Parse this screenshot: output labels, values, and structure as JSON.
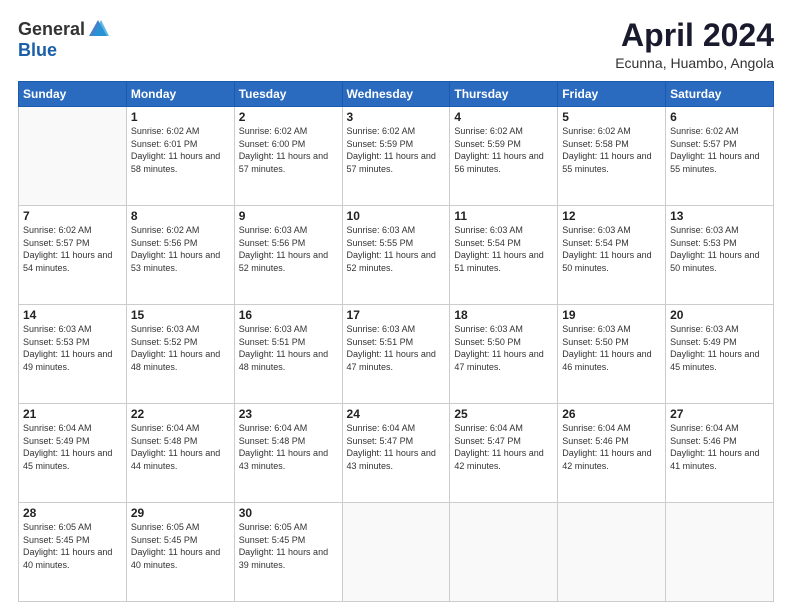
{
  "header": {
    "logo_general": "General",
    "logo_blue": "Blue",
    "title": "April 2024",
    "location": "Ecunna, Huambo, Angola"
  },
  "days_of_week": [
    "Sunday",
    "Monday",
    "Tuesday",
    "Wednesday",
    "Thursday",
    "Friday",
    "Saturday"
  ],
  "weeks": [
    [
      {
        "day": "",
        "sunrise": "",
        "sunset": "",
        "daylight": ""
      },
      {
        "day": "1",
        "sunrise": "Sunrise: 6:02 AM",
        "sunset": "Sunset: 6:01 PM",
        "daylight": "Daylight: 11 hours and 58 minutes."
      },
      {
        "day": "2",
        "sunrise": "Sunrise: 6:02 AM",
        "sunset": "Sunset: 6:00 PM",
        "daylight": "Daylight: 11 hours and 57 minutes."
      },
      {
        "day": "3",
        "sunrise": "Sunrise: 6:02 AM",
        "sunset": "Sunset: 5:59 PM",
        "daylight": "Daylight: 11 hours and 57 minutes."
      },
      {
        "day": "4",
        "sunrise": "Sunrise: 6:02 AM",
        "sunset": "Sunset: 5:59 PM",
        "daylight": "Daylight: 11 hours and 56 minutes."
      },
      {
        "day": "5",
        "sunrise": "Sunrise: 6:02 AM",
        "sunset": "Sunset: 5:58 PM",
        "daylight": "Daylight: 11 hours and 55 minutes."
      },
      {
        "day": "6",
        "sunrise": "Sunrise: 6:02 AM",
        "sunset": "Sunset: 5:57 PM",
        "daylight": "Daylight: 11 hours and 55 minutes."
      }
    ],
    [
      {
        "day": "7",
        "sunrise": "Sunrise: 6:02 AM",
        "sunset": "Sunset: 5:57 PM",
        "daylight": "Daylight: 11 hours and 54 minutes."
      },
      {
        "day": "8",
        "sunrise": "Sunrise: 6:02 AM",
        "sunset": "Sunset: 5:56 PM",
        "daylight": "Daylight: 11 hours and 53 minutes."
      },
      {
        "day": "9",
        "sunrise": "Sunrise: 6:03 AM",
        "sunset": "Sunset: 5:56 PM",
        "daylight": "Daylight: 11 hours and 52 minutes."
      },
      {
        "day": "10",
        "sunrise": "Sunrise: 6:03 AM",
        "sunset": "Sunset: 5:55 PM",
        "daylight": "Daylight: 11 hours and 52 minutes."
      },
      {
        "day": "11",
        "sunrise": "Sunrise: 6:03 AM",
        "sunset": "Sunset: 5:54 PM",
        "daylight": "Daylight: 11 hours and 51 minutes."
      },
      {
        "day": "12",
        "sunrise": "Sunrise: 6:03 AM",
        "sunset": "Sunset: 5:54 PM",
        "daylight": "Daylight: 11 hours and 50 minutes."
      },
      {
        "day": "13",
        "sunrise": "Sunrise: 6:03 AM",
        "sunset": "Sunset: 5:53 PM",
        "daylight": "Daylight: 11 hours and 50 minutes."
      }
    ],
    [
      {
        "day": "14",
        "sunrise": "Sunrise: 6:03 AM",
        "sunset": "Sunset: 5:53 PM",
        "daylight": "Daylight: 11 hours and 49 minutes."
      },
      {
        "day": "15",
        "sunrise": "Sunrise: 6:03 AM",
        "sunset": "Sunset: 5:52 PM",
        "daylight": "Daylight: 11 hours and 48 minutes."
      },
      {
        "day": "16",
        "sunrise": "Sunrise: 6:03 AM",
        "sunset": "Sunset: 5:51 PM",
        "daylight": "Daylight: 11 hours and 48 minutes."
      },
      {
        "day": "17",
        "sunrise": "Sunrise: 6:03 AM",
        "sunset": "Sunset: 5:51 PM",
        "daylight": "Daylight: 11 hours and 47 minutes."
      },
      {
        "day": "18",
        "sunrise": "Sunrise: 6:03 AM",
        "sunset": "Sunset: 5:50 PM",
        "daylight": "Daylight: 11 hours and 47 minutes."
      },
      {
        "day": "19",
        "sunrise": "Sunrise: 6:03 AM",
        "sunset": "Sunset: 5:50 PM",
        "daylight": "Daylight: 11 hours and 46 minutes."
      },
      {
        "day": "20",
        "sunrise": "Sunrise: 6:03 AM",
        "sunset": "Sunset: 5:49 PM",
        "daylight": "Daylight: 11 hours and 45 minutes."
      }
    ],
    [
      {
        "day": "21",
        "sunrise": "Sunrise: 6:04 AM",
        "sunset": "Sunset: 5:49 PM",
        "daylight": "Daylight: 11 hours and 45 minutes."
      },
      {
        "day": "22",
        "sunrise": "Sunrise: 6:04 AM",
        "sunset": "Sunset: 5:48 PM",
        "daylight": "Daylight: 11 hours and 44 minutes."
      },
      {
        "day": "23",
        "sunrise": "Sunrise: 6:04 AM",
        "sunset": "Sunset: 5:48 PM",
        "daylight": "Daylight: 11 hours and 43 minutes."
      },
      {
        "day": "24",
        "sunrise": "Sunrise: 6:04 AM",
        "sunset": "Sunset: 5:47 PM",
        "daylight": "Daylight: 11 hours and 43 minutes."
      },
      {
        "day": "25",
        "sunrise": "Sunrise: 6:04 AM",
        "sunset": "Sunset: 5:47 PM",
        "daylight": "Daylight: 11 hours and 42 minutes."
      },
      {
        "day": "26",
        "sunrise": "Sunrise: 6:04 AM",
        "sunset": "Sunset: 5:46 PM",
        "daylight": "Daylight: 11 hours and 42 minutes."
      },
      {
        "day": "27",
        "sunrise": "Sunrise: 6:04 AM",
        "sunset": "Sunset: 5:46 PM",
        "daylight": "Daylight: 11 hours and 41 minutes."
      }
    ],
    [
      {
        "day": "28",
        "sunrise": "Sunrise: 6:05 AM",
        "sunset": "Sunset: 5:45 PM",
        "daylight": "Daylight: 11 hours and 40 minutes."
      },
      {
        "day": "29",
        "sunrise": "Sunrise: 6:05 AM",
        "sunset": "Sunset: 5:45 PM",
        "daylight": "Daylight: 11 hours and 40 minutes."
      },
      {
        "day": "30",
        "sunrise": "Sunrise: 6:05 AM",
        "sunset": "Sunset: 5:45 PM",
        "daylight": "Daylight: 11 hours and 39 minutes."
      },
      {
        "day": "",
        "sunrise": "",
        "sunset": "",
        "daylight": ""
      },
      {
        "day": "",
        "sunrise": "",
        "sunset": "",
        "daylight": ""
      },
      {
        "day": "",
        "sunrise": "",
        "sunset": "",
        "daylight": ""
      },
      {
        "day": "",
        "sunrise": "",
        "sunset": "",
        "daylight": ""
      }
    ]
  ]
}
